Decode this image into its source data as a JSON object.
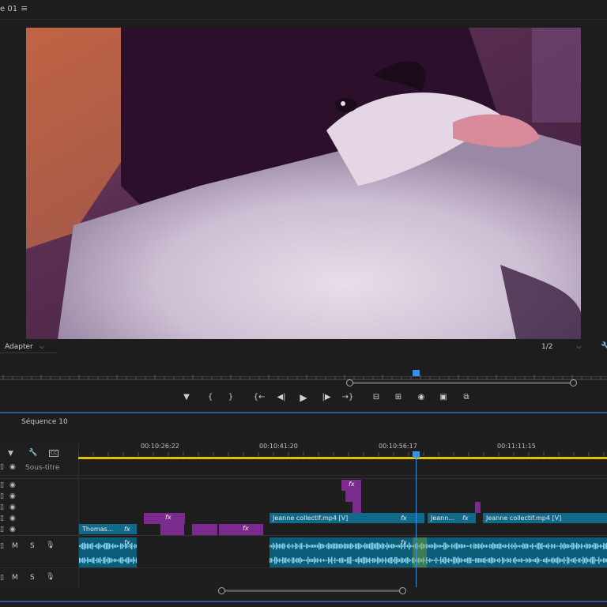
{
  "monitor": {
    "title": "e 01",
    "fit_label": "Adapter",
    "resolution_label": "1/2"
  },
  "transport": {
    "icons": [
      "marker-icon",
      "mark-in-icon",
      "mark-out-icon",
      "go-to-in-icon",
      "step-back-icon",
      "play-icon",
      "step-forward-icon",
      "go-to-out-icon",
      "lift-icon",
      "extract-icon",
      "export-frame-icon",
      "compare-icon",
      "multicam-icon"
    ]
  },
  "timeline": {
    "sequence_title": "Séquence 10",
    "timecodes": [
      "00:10:26:22",
      "00:10:41:20",
      "00:10:56:17",
      "00:11:11:15"
    ],
    "caption_track_label": "Sous-titre",
    "clips": {
      "thomas": "Thomas...",
      "jeanne1": "Jeanne collectif.mp4 [V]",
      "jeanne2": "Jeann...",
      "jeanne3": "Jeanne collectif.mp4 [V]",
      "fx": "fx"
    },
    "audio_track_buttons": {
      "mute": "M",
      "solo": "S"
    }
  },
  "colors": {
    "accent_blue": "#3b8ee5",
    "video_clip": "#126a8a",
    "adjustment_clip": "#7b2a8e",
    "work_area": "#e0c200"
  }
}
